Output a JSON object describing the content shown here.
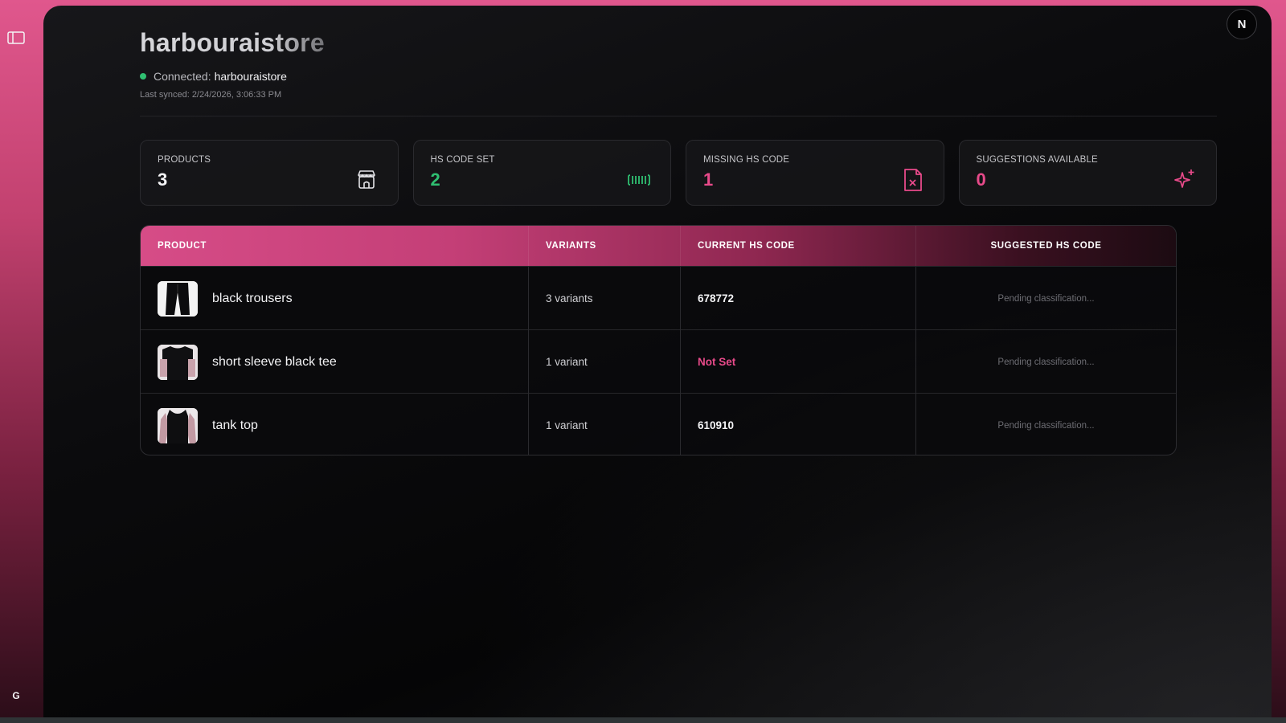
{
  "header": {
    "title": "harbouraistore",
    "connected_label": "Connected:",
    "connected_store": "harbouraistore",
    "last_synced": "Last synced: 2/24/2026, 3:06:33 PM"
  },
  "topbar": {
    "avatar_initial": "N"
  },
  "rail": {
    "user_initial": "G"
  },
  "stats": [
    {
      "label": "PRODUCTS",
      "value": "3",
      "color": "#f4f4f6",
      "icon": "store-icon"
    },
    {
      "label": "HS CODE SET",
      "value": "2",
      "color": "#2fbf71",
      "icon": "barcode-icon"
    },
    {
      "label": "MISSING HS CODE",
      "value": "1",
      "color": "#e84a8a",
      "icon": "file-x-icon"
    },
    {
      "label": "SUGGESTIONS AVAILABLE",
      "value": "0",
      "color": "#e84a8a",
      "icon": "sparkles-icon"
    }
  ],
  "table": {
    "columns": [
      "PRODUCT",
      "VARIANTS",
      "CURRENT HS CODE",
      "SUGGESTED HS CODE"
    ],
    "rows": [
      {
        "name": "black trousers",
        "variants": "3 variants",
        "hs_code": "678772",
        "suggested": "Pending classification..."
      },
      {
        "name": "short sleeve black tee",
        "variants": "1 variant",
        "hs_code": "Not Set",
        "suggested": "Pending classification..."
      },
      {
        "name": "tank top",
        "variants": "1 variant",
        "hs_code": "610910",
        "suggested": "Pending classification..."
      }
    ]
  },
  "colors": {
    "accent_pink": "#e84a8a",
    "success_green": "#2fbf71",
    "panel_bg": "#0b0b0d"
  }
}
